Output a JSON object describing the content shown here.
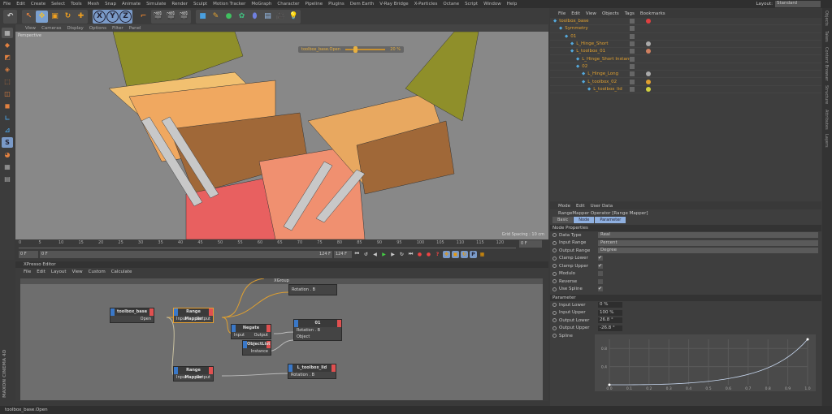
{
  "menubar": {
    "items": [
      "File",
      "Edit",
      "Create",
      "Select",
      "Tools",
      "Mesh",
      "Snap",
      "Animate",
      "Simulate",
      "Render",
      "Sculpt",
      "Motion Tracker",
      "MoGraph",
      "Character",
      "Pipeline",
      "Plugins",
      "Dem Earth",
      "V-Ray Bridge",
      "X-Particles",
      "Octane",
      "Script",
      "Window",
      "Help"
    ],
    "layout_label": "Layout:",
    "layout_value": "Standard"
  },
  "toolbar": {
    "axis": [
      "X",
      "Y",
      "Z"
    ]
  },
  "viewport": {
    "menu": [
      "View",
      "Cameras",
      "Display",
      "Options",
      "Filter",
      "Panel"
    ],
    "camera": "Perspective",
    "hud_label": "toolbox_base.Open",
    "hud_value": "20 %",
    "hud_fraction": 0.2,
    "grid_spacing": "Grid Spacing : 10 cm"
  },
  "timeline": {
    "ticks": [
      "0",
      "5",
      "10",
      "15",
      "20",
      "25",
      "30",
      "35",
      "40",
      "45",
      "50",
      "55",
      "60",
      "65",
      "70",
      "75",
      "80",
      "85",
      "90",
      "95",
      "100",
      "105",
      "110",
      "115",
      "120"
    ],
    "current_frame": "0 F",
    "start": "0 F",
    "range_start": "0 F",
    "range_end": "124 F",
    "end": "124 F",
    "frame_display": "0 F"
  },
  "xpresso": {
    "title": "XPresso Editor",
    "menu": [
      "File",
      "Edit",
      "Layout",
      "View",
      "Custom",
      "Calculate"
    ],
    "group": "XGroup",
    "nodes": {
      "base": {
        "title": "toolbox_base",
        "out": "Open"
      },
      "rm1": {
        "title": "Range Mapper",
        "in": "Input",
        "out": "Output"
      },
      "rot_top": {
        "port": "Rotation . B"
      },
      "negate": {
        "title": "Negate",
        "in": "Input",
        "out": "Output"
      },
      "n01": {
        "title": "01",
        "p1": "Rotation . B",
        "p2": "Object"
      },
      "objlist": {
        "title": "ObjectList",
        "out": "Instance"
      },
      "rm2": {
        "title": "Range Mapper",
        "in": "Input",
        "out": "Output"
      },
      "lid": {
        "title": "L_toolbox_lid",
        "port": "Rotation . B"
      }
    }
  },
  "status": "toolbox_base.Open",
  "brand": "MAXON CINEMA 4D",
  "objects": {
    "menu": [
      "File",
      "Edit",
      "View",
      "Objects",
      "Tags",
      "Bookmarks"
    ],
    "items": [
      {
        "name": "toolbox_base",
        "depth": 0,
        "color": "#e04040"
      },
      {
        "name": "Symmetry",
        "depth": 1,
        "color": ""
      },
      {
        "name": "01",
        "depth": 2,
        "color": ""
      },
      {
        "name": "L_Hinge_Short",
        "depth": 3,
        "color": "#aaaaaa"
      },
      {
        "name": "L_toolbox_01",
        "depth": 3,
        "color": "#d08060"
      },
      {
        "name": "L_Hinge_Short Instance",
        "depth": 4,
        "color": ""
      },
      {
        "name": "02",
        "depth": 4,
        "color": ""
      },
      {
        "name": "L_Hinge_Long",
        "depth": 5,
        "color": "#aaaaaa"
      },
      {
        "name": "L_toolbox_02",
        "depth": 5,
        "color": "#e0a030"
      },
      {
        "name": "L_toolbox_lid",
        "depth": 6,
        "color": "#d0d040"
      }
    ]
  },
  "side_tabs": [
    "Objects",
    "Takes",
    "Content Browser",
    "Structure",
    "Attributes",
    "Layers"
  ],
  "attributes": {
    "menu": [
      "Mode",
      "Edit",
      "User Data"
    ],
    "title": "RangeMapper Operator [Range Mapper]",
    "tabs": [
      "Basic",
      "Node",
      "Parameter"
    ],
    "active_tabs": [
      "Node",
      "Parameter"
    ],
    "section1": "Node Properties",
    "props": [
      {
        "label": "Data Type",
        "value": "Real"
      },
      {
        "label": "Input Range",
        "value": "Percent"
      },
      {
        "label": "Output Range",
        "value": "Degree"
      }
    ],
    "checks": [
      {
        "label": "Clamp Lower",
        "checked": true
      },
      {
        "label": "Clamp Upper",
        "checked": true
      },
      {
        "label": "Modulo",
        "checked": false
      },
      {
        "label": "Reverse",
        "checked": false
      },
      {
        "label": "Use Spline",
        "checked": true
      }
    ],
    "section2": "Parameter",
    "params": [
      {
        "label": "Input Lower",
        "value": "0 %"
      },
      {
        "label": "Input Upper",
        "value": "100 %"
      },
      {
        "label": "Output Lower",
        "value": "26.8 °"
      },
      {
        "label": "Output Upper",
        "value": "-26.8 °"
      }
    ],
    "spline_label": "Spline",
    "spline": {
      "x_ticks": [
        "0.0",
        "0.1",
        "0.2",
        "0.3",
        "0.4",
        "0.5",
        "0.6",
        "0.7",
        "0.8",
        "0.9",
        "1.0"
      ],
      "y_ticks": [
        "0.4",
        "0.8"
      ]
    }
  }
}
